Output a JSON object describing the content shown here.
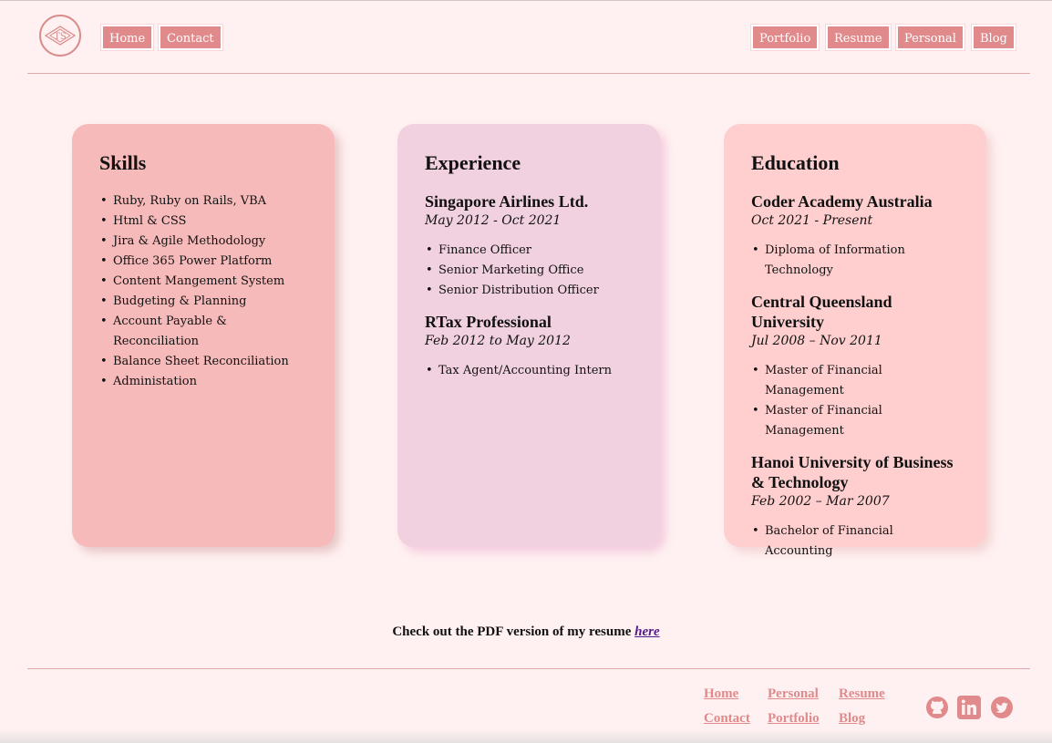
{
  "header": {
    "logo_icon": "logo-monogram-icon",
    "nav_left": [
      {
        "label": "Home"
      },
      {
        "label": "Contact"
      }
    ],
    "nav_right": [
      {
        "label": "Portfolio"
      },
      {
        "label": "Resume"
      },
      {
        "label": "Personal"
      },
      {
        "label": "Blog"
      }
    ]
  },
  "skills": {
    "title": "Skills",
    "items": [
      "Ruby, Ruby on Rails, VBA",
      "Html & CSS",
      "Jira & Agile Methodology",
      "Office 365 Power Platform",
      "Content Mangement System",
      "Budgeting & Planning",
      "Account Payable & Reconciliation",
      "Balance Sheet Reconciliation",
      "Administation"
    ]
  },
  "experience": {
    "title": "Experience",
    "jobs": [
      {
        "company": "Singapore Airlines Ltd.",
        "dates": "May 2012 - Oct 2021",
        "roles": [
          "Finance Officer",
          "Senior Marketing Office",
          "Senior Distribution Officer"
        ]
      },
      {
        "company": "RTax Professional",
        "dates": "Feb 2012 to May 2012",
        "roles": [
          "Tax Agent/Accounting Intern"
        ]
      }
    ]
  },
  "education": {
    "title": "Education",
    "schools": [
      {
        "name": "Coder Academy Australia",
        "dates": "Oct 2021 - Present",
        "degrees": [
          "Diploma of Information Technology"
        ]
      },
      {
        "name": "Central Queensland University",
        "dates": "Jul 2008 – Nov 2011",
        "degrees": [
          "Master of Financial Management",
          "Master of Financial Management"
        ]
      },
      {
        "name": "Hanoi University of Business & Technology",
        "dates": "Feb 2002 – Mar 2007",
        "degrees": [
          "Bachelor of Financial Accounting"
        ]
      }
    ]
  },
  "pdf": {
    "text": "Check out the PDF version of my resume ",
    "link": "here"
  },
  "footer": {
    "links": [
      "Home",
      "Personal",
      "Resume",
      "Contact",
      "Portfolio",
      "Blog"
    ],
    "social_icons": [
      "github-icon",
      "linkedin-icon",
      "twitter-icon"
    ],
    "accent": "#e08a8c"
  }
}
